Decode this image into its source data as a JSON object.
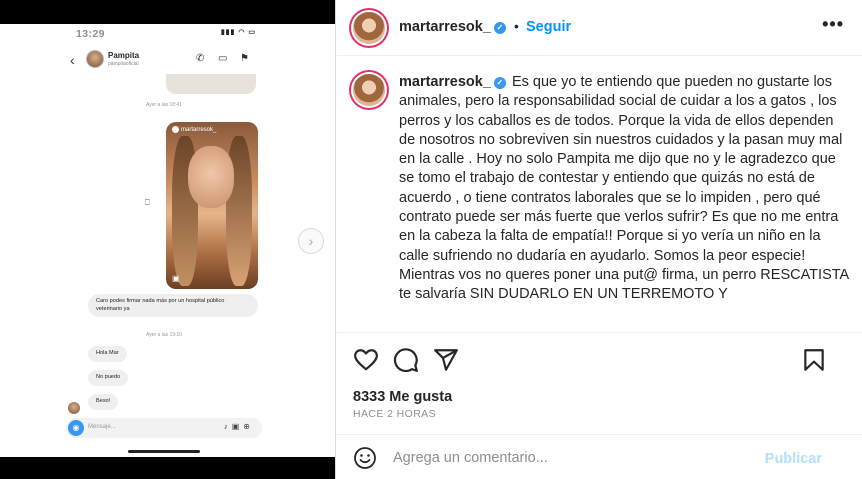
{
  "phone": {
    "status_time": "13:29",
    "status_icons": "▮▮▮ ◠ ▭",
    "contact_name": "Pampita",
    "contact_handle": "pampitaoficial",
    "timestamp_1": "Ayer a las 18:41",
    "reel_user": "martarresok_",
    "message_1": "Caro podes firmar nada más por un hospital público veterinario ya",
    "timestamp_2": "Ayer a las 19:10",
    "message_2": "Hola Mar",
    "message_3": "No puedo",
    "message_4": "Beso!",
    "input_placeholder": "Mensaje..."
  },
  "post": {
    "username": "martarresok_",
    "verified_mark": "✓",
    "dot": "•",
    "follow_label": "Seguir",
    "more_label": "•••",
    "caption": "Es que yo te entiendo que pueden no gustarte los animales, pero la responsabilidad social de cuidar a los a gatos , los perros y los caballos es de todos. Porque la vida de ellos dependen de nosotros no sobreviven sin nuestros cuidados y la pasan muy mal en la calle . Hoy no solo Pampita me dijo que no y le agradezco que se tomo el trabajo de contestar y entiendo que quizás no está de acuerdo , o tiene contratos laborales que se lo impiden , pero qué contrato puede ser más fuerte que verlos sufrir? Es que no me entra en la cabeza la falta de empatía!! Porque si yo vería un niño en la calle sufriendo no dudaría en ayudarlo. Somos la peor especie!\nMientras vos no queres poner una put@ firma, un perro RESCATISTA te salvaría SIN DUDARLO EN UN TERREMOTO Y",
    "likes": "8333 Me gusta",
    "time_ago": "HACE 2 HORAS",
    "comment_placeholder": "Agrega un comentario...",
    "publish_label": "Publicar"
  },
  "colors": {
    "accent": "#0095f6",
    "verified": "#3897f0",
    "publish_disabled": "#b2dffc",
    "muted": "#8e8e8e"
  },
  "icons": [
    "like-icon",
    "comment-icon",
    "share-icon",
    "save-icon",
    "emoji-icon",
    "next-arrow-icon",
    "camera-icon",
    "mic-icon",
    "gallery-icon",
    "sticker-icon",
    "phone-icon",
    "video-icon",
    "flag-icon",
    "back-icon"
  ]
}
